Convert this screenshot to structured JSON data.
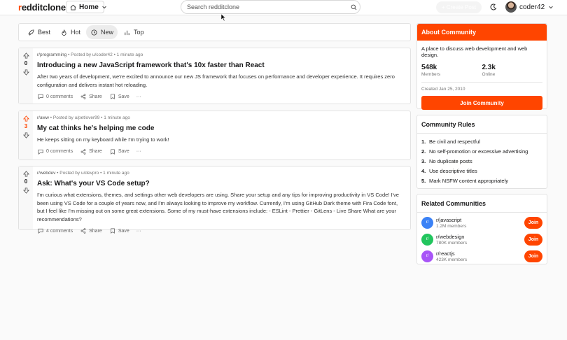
{
  "header": {
    "logo_r": "r",
    "logo_rest": "edditclone",
    "home_label": "Home",
    "search_placeholder": "Search redditclone",
    "create_post_label": "+ Create Post",
    "username": "coder42"
  },
  "sortbar": {
    "items": [
      {
        "label": "Best",
        "icon": "rocket-icon"
      },
      {
        "label": "Hot",
        "icon": "flame-icon"
      },
      {
        "label": "New",
        "icon": "clock-icon",
        "active": true
      },
      {
        "label": "Top",
        "icon": "bar-chart-icon"
      }
    ]
  },
  "posts": [
    {
      "subreddit": "r/programming",
      "author": "Posted by u/coder42",
      "time": "1 minute ago",
      "title": "Introducing a new JavaScript framework that's 10x faster than React",
      "text": "After two years of development, we're excited to announce our new JS framework that focuses on performance and developer experience. It requires zero configuration and delivers instant hot reloading.",
      "votes": "0",
      "comments": "0 comments",
      "share": "Share",
      "save": "Save"
    },
    {
      "subreddit": "r/aww",
      "author": "Posted by u/petlover99",
      "time": "1 minute ago",
      "title": "My cat thinks he's helping me code",
      "text": "He keeps sitting on my keyboard while I'm trying to work!",
      "votes": "3",
      "comments": "0 comments",
      "share": "Share",
      "save": "Save"
    },
    {
      "subreddit": "r/webdev",
      "author": "Posted by u/devpro",
      "time": "1 minute ago",
      "title": "Ask: What's your VS Code setup?",
      "text": "I'm curious what extensions, themes, and settings other web developers are using. Share your setup and any tips for improving productivity in VS Code! I've been using VS Code for a couple of years now, and I'm always looking to improve my workflow. Currently, I'm using GitHub Dark theme with Fira Code font, but I feel like I'm missing out on some great extensions. Some of my must-have extensions include: - ESLint - Prettier - GitLens - Live Share What are your recommendations?",
      "votes": "0",
      "comments": "4 comments",
      "share": "Share",
      "save": "Save"
    }
  ],
  "about": {
    "title": "About Community",
    "description": "A place to discuss web development and web design.",
    "members_value": "548k",
    "members_label": "Members",
    "online_value": "2.3k",
    "online_label": "Online",
    "created": "Created Jan 25, 2010",
    "join_label": "Join Community"
  },
  "rules": {
    "title": "Community Rules",
    "items": [
      {
        "n": "1.",
        "text": "Be civil and respectful"
      },
      {
        "n": "2.",
        "text": "No self-promotion or excessive advertising"
      },
      {
        "n": "3.",
        "text": "No duplicate posts"
      },
      {
        "n": "4.",
        "text": "Use descriptive titles"
      },
      {
        "n": "5.",
        "text": "Mark NSFW content appropriately"
      }
    ]
  },
  "related": {
    "title": "Related Communities",
    "items": [
      {
        "icon": "r/",
        "name": "r/javascript",
        "members": "1.2M members",
        "join": "Join",
        "color": "#3b82f6"
      },
      {
        "icon": "r/",
        "name": "r/webdesign",
        "members": "780K members",
        "join": "Join",
        "color": "#22c55e"
      },
      {
        "icon": "r/",
        "name": "r/reactjs",
        "members": "423K members",
        "join": "Join",
        "color": "#a855f7"
      }
    ]
  },
  "colors": {
    "accent": "#ff4500"
  }
}
